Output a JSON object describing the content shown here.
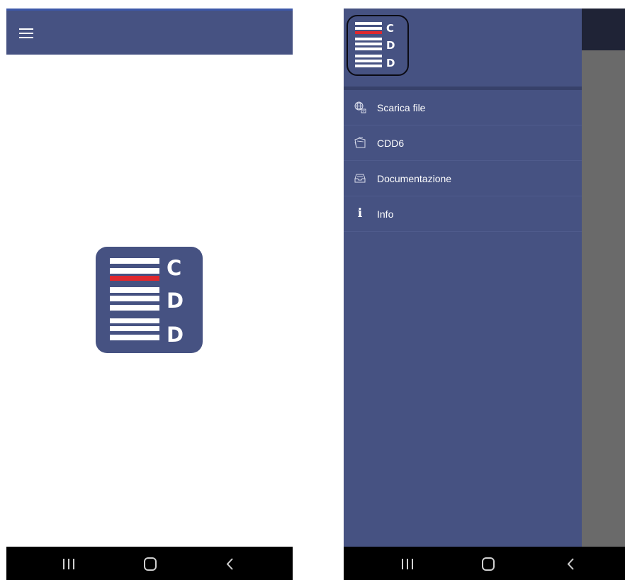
{
  "logo": {
    "letters": [
      "C",
      "D",
      "D"
    ],
    "background_color": "#465282",
    "accent_color": "#e0282e"
  },
  "drawer": {
    "items": [
      {
        "label": "Scarica file",
        "icon": "globe-download-icon"
      },
      {
        "label": "CDD6",
        "icon": "folder-stack-icon"
      },
      {
        "label": "Documentazione",
        "icon": "inbox-tray-icon"
      },
      {
        "label": "Info",
        "icon": "info-icon"
      }
    ]
  },
  "system_nav": {
    "recents_icon": "recents-icon",
    "home_icon": "home-icon",
    "back_icon": "back-icon"
  },
  "colors": {
    "app_bar": "#465282",
    "drawer_background": "#465282",
    "scrim": "#6a6a6a",
    "system_nav": "#000000"
  }
}
